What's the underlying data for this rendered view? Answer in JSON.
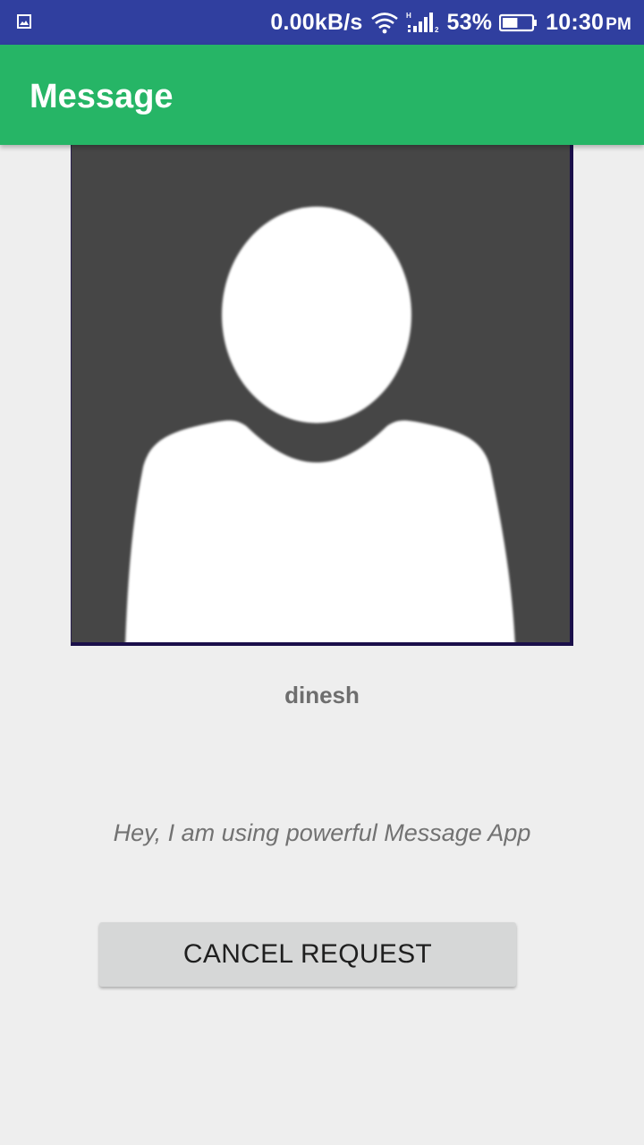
{
  "status_bar": {
    "network_speed": "0.00kB/s",
    "battery_percent": "53%",
    "time": "10:30",
    "ampm": "PM",
    "battery_level": 0.53,
    "icons": [
      "gallery-icon",
      "wifi-icon",
      "signal-icon",
      "battery-icon"
    ]
  },
  "app_bar": {
    "title": "Message"
  },
  "profile": {
    "image_icon": "default-avatar-icon",
    "name": "dinesh",
    "status": "Hey, I am using powerful Message App"
  },
  "actions": {
    "cancel_request_label": "CANCEL REQUEST"
  },
  "colors": {
    "status_bar": "#303f9f",
    "app_bar": "#26b566",
    "background": "#eeeeee",
    "avatar_bg": "#464646",
    "button": "#d6d7d7"
  }
}
